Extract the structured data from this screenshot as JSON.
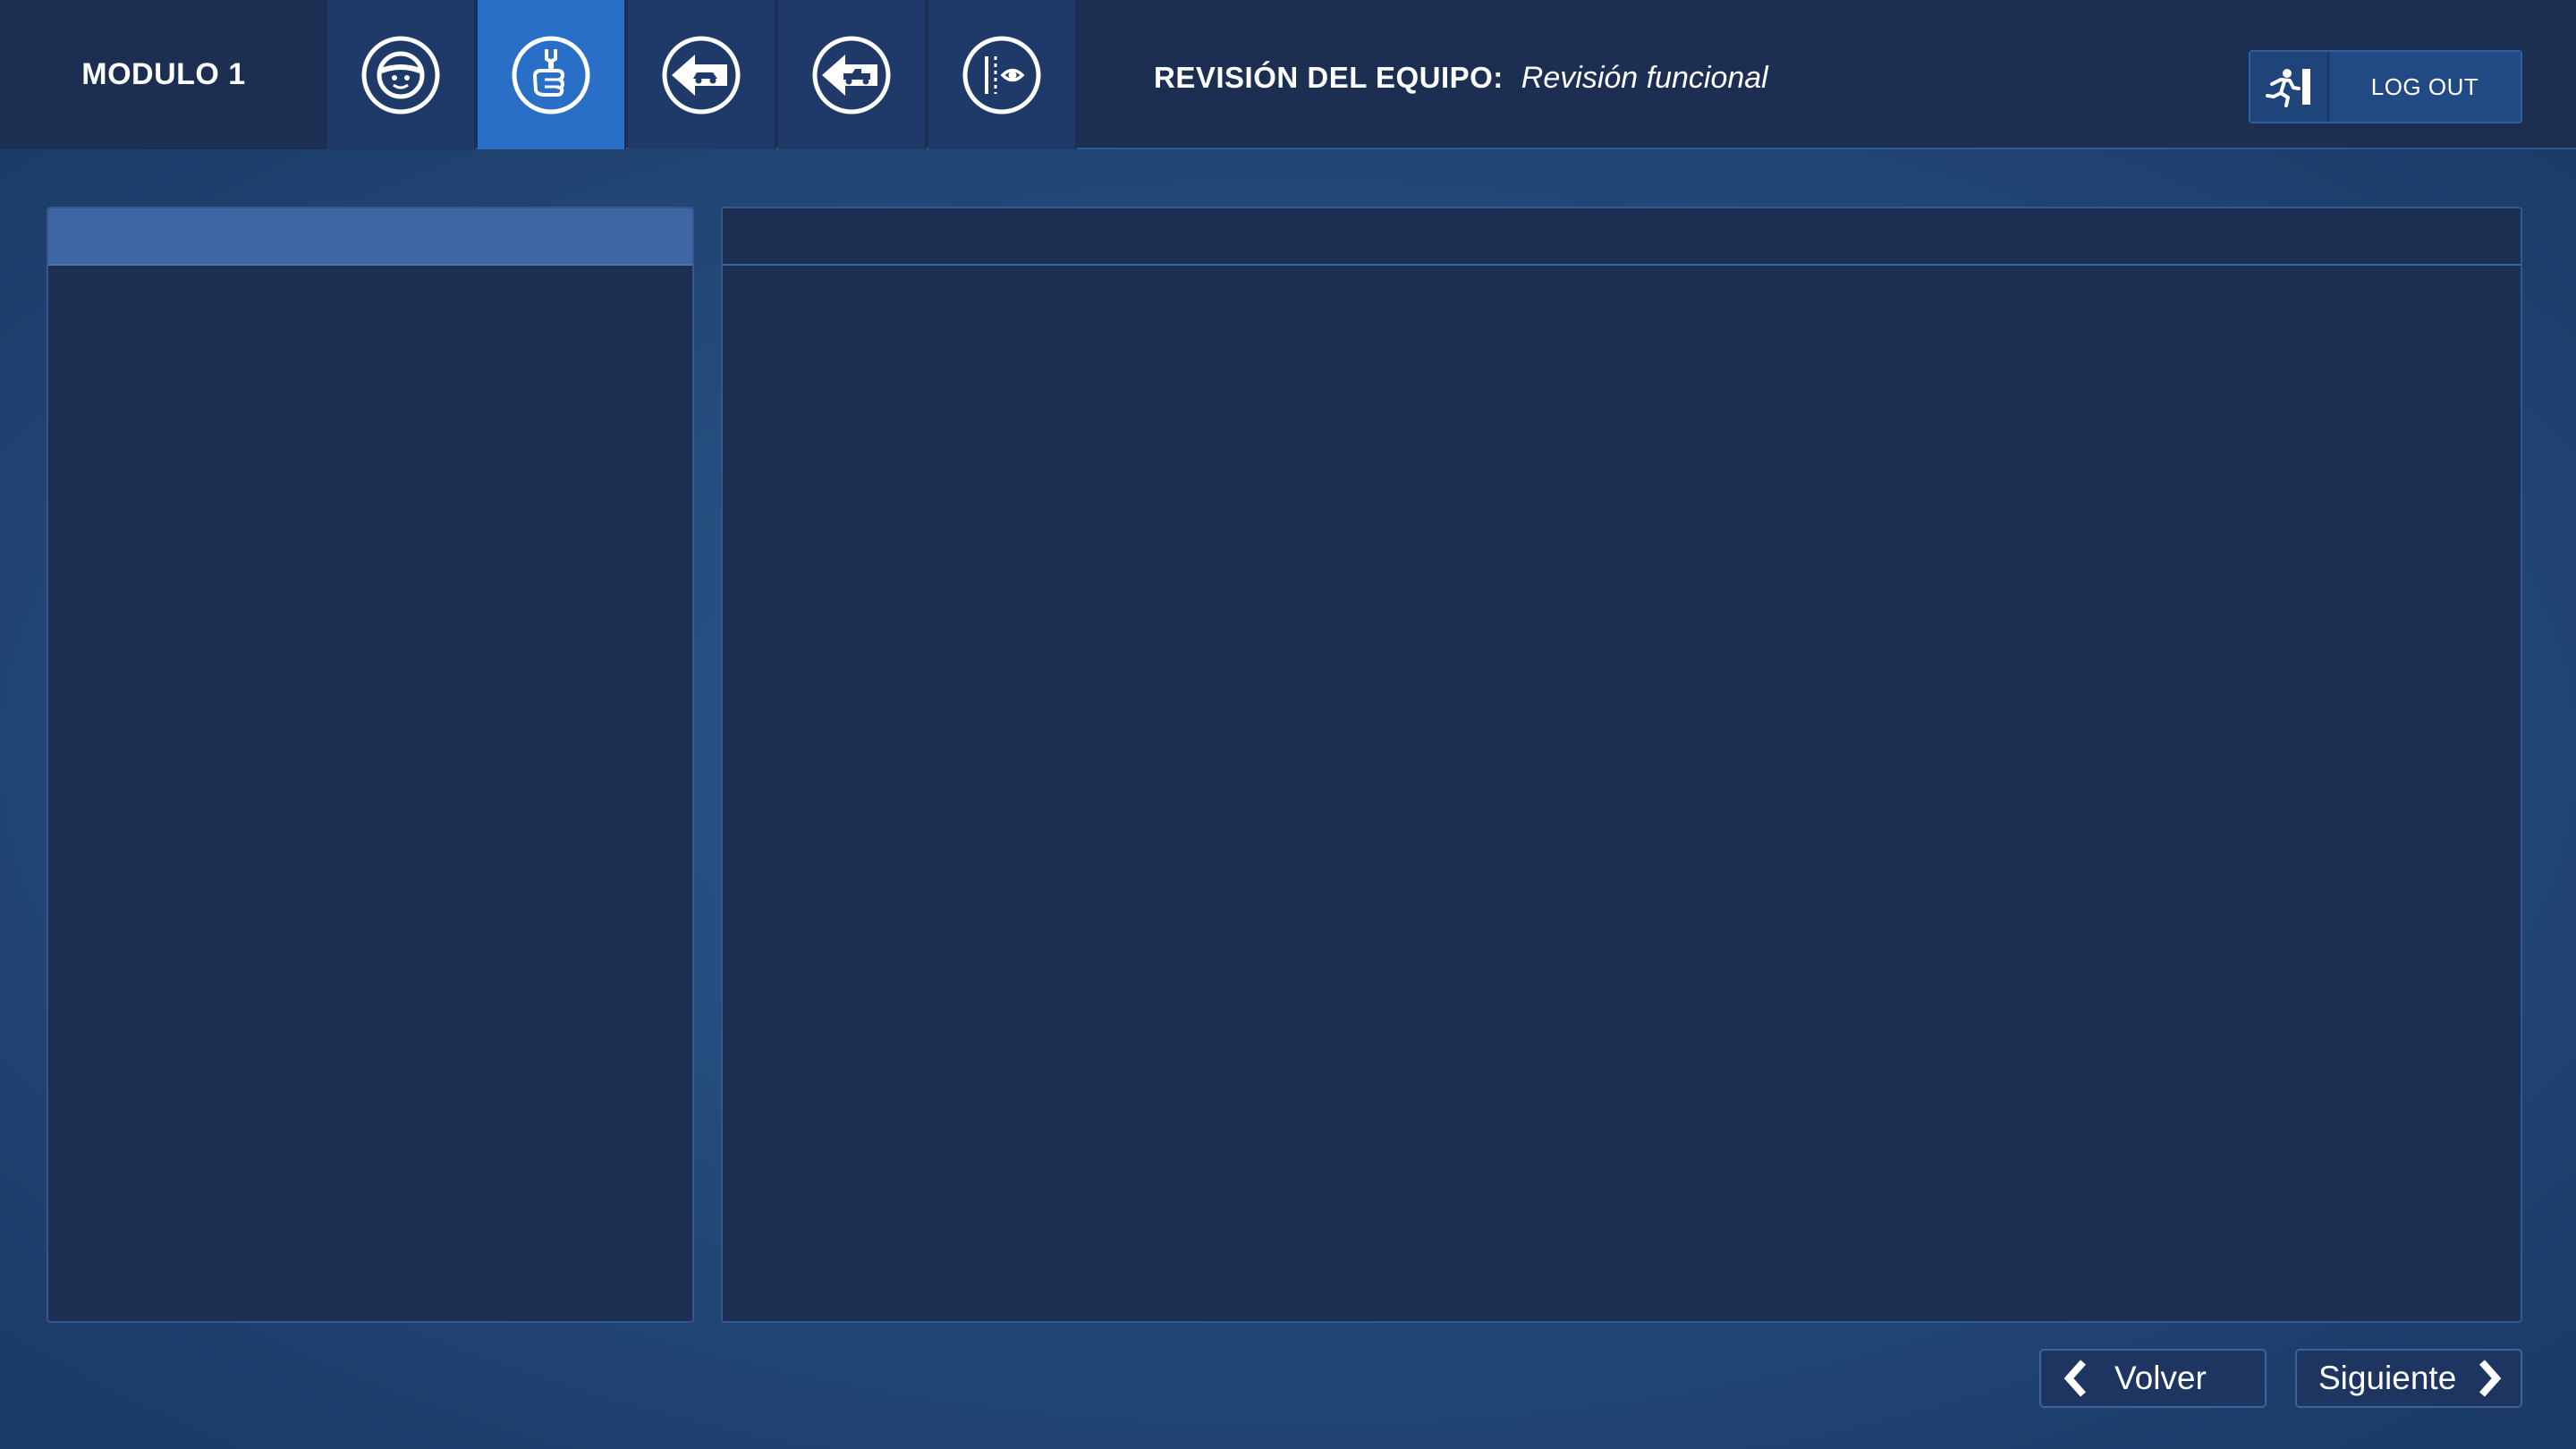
{
  "header": {
    "module_title": "MODULO 1",
    "tabs": [
      {
        "icon": "driver-icon",
        "active": false
      },
      {
        "icon": "thumbs-up-wrench-icon",
        "active": true
      },
      {
        "icon": "reverse-car-icon",
        "active": false
      },
      {
        "icon": "reverse-truck-icon",
        "active": false
      },
      {
        "icon": "mirror-eye-icon",
        "active": false
      }
    ],
    "screen_title": "REVISIÓN DEL EQUIPO:",
    "screen_subtitle": "Revisión funcional",
    "logout_label": "LOG OUT"
  },
  "footer": {
    "back_label": "Volver",
    "next_label": "Siguiente"
  },
  "colors": {
    "topbar": "#1c2f52",
    "active_tab": "#2a6fc7",
    "inactive_tab": "#1f3a68",
    "panel": "#1c2f52",
    "left_panel_header": "#3e66a4"
  }
}
